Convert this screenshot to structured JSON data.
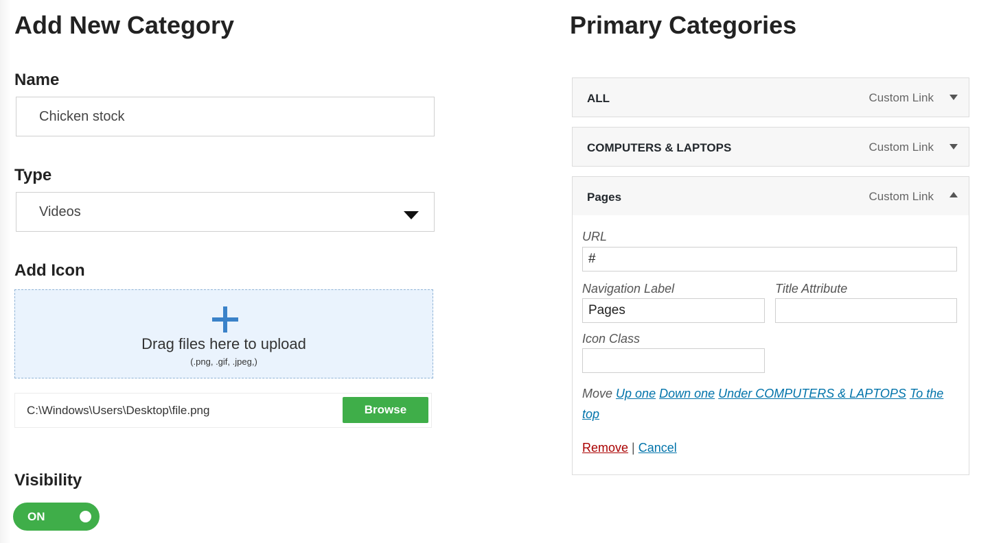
{
  "add_category": {
    "title": "Add New Category",
    "name": {
      "label": "Name",
      "value": "Chicken stock"
    },
    "type": {
      "label": "Type",
      "selected": "Videos"
    },
    "icon": {
      "label": "Add Icon",
      "drop_text": "Drag files here to upload",
      "drop_hint": "(.png, .gif, .jpeg,)",
      "file_path": "C:\\Windows\\Users\\Desktop\\file.png",
      "browse_label": "Browse"
    },
    "visibility": {
      "label": "Visibility",
      "state": "ON"
    }
  },
  "primary_categories": {
    "title": "Primary Categories",
    "items": [
      {
        "title": "ALL",
        "type": "Custom Link",
        "expanded": false
      },
      {
        "title": "COMPUTERS & LAPTOPS",
        "type": "Custom Link",
        "expanded": false
      },
      {
        "title": "Pages",
        "type": "Custom Link",
        "expanded": true
      }
    ],
    "edit_form": {
      "url_label": "URL",
      "url_value": "#",
      "nav_label": "Navigation Label",
      "nav_value": "Pages",
      "title_attr_label": "Title Attribute",
      "title_attr_value": "",
      "icon_class_label": "Icon Class",
      "icon_class_value": "",
      "move_label": "Move",
      "move_up": "Up one",
      "move_down": "Down one",
      "move_under": "Under COMPUTERS & LAPTOPS",
      "move_top": "To the top",
      "remove": "Remove",
      "separator": "|",
      "cancel": "Cancel"
    }
  },
  "colors": {
    "accent_green": "#3fae49",
    "link_blue": "#0073aa",
    "remove_red": "#aa0000",
    "dropzone_bg": "#eaf3fd"
  }
}
